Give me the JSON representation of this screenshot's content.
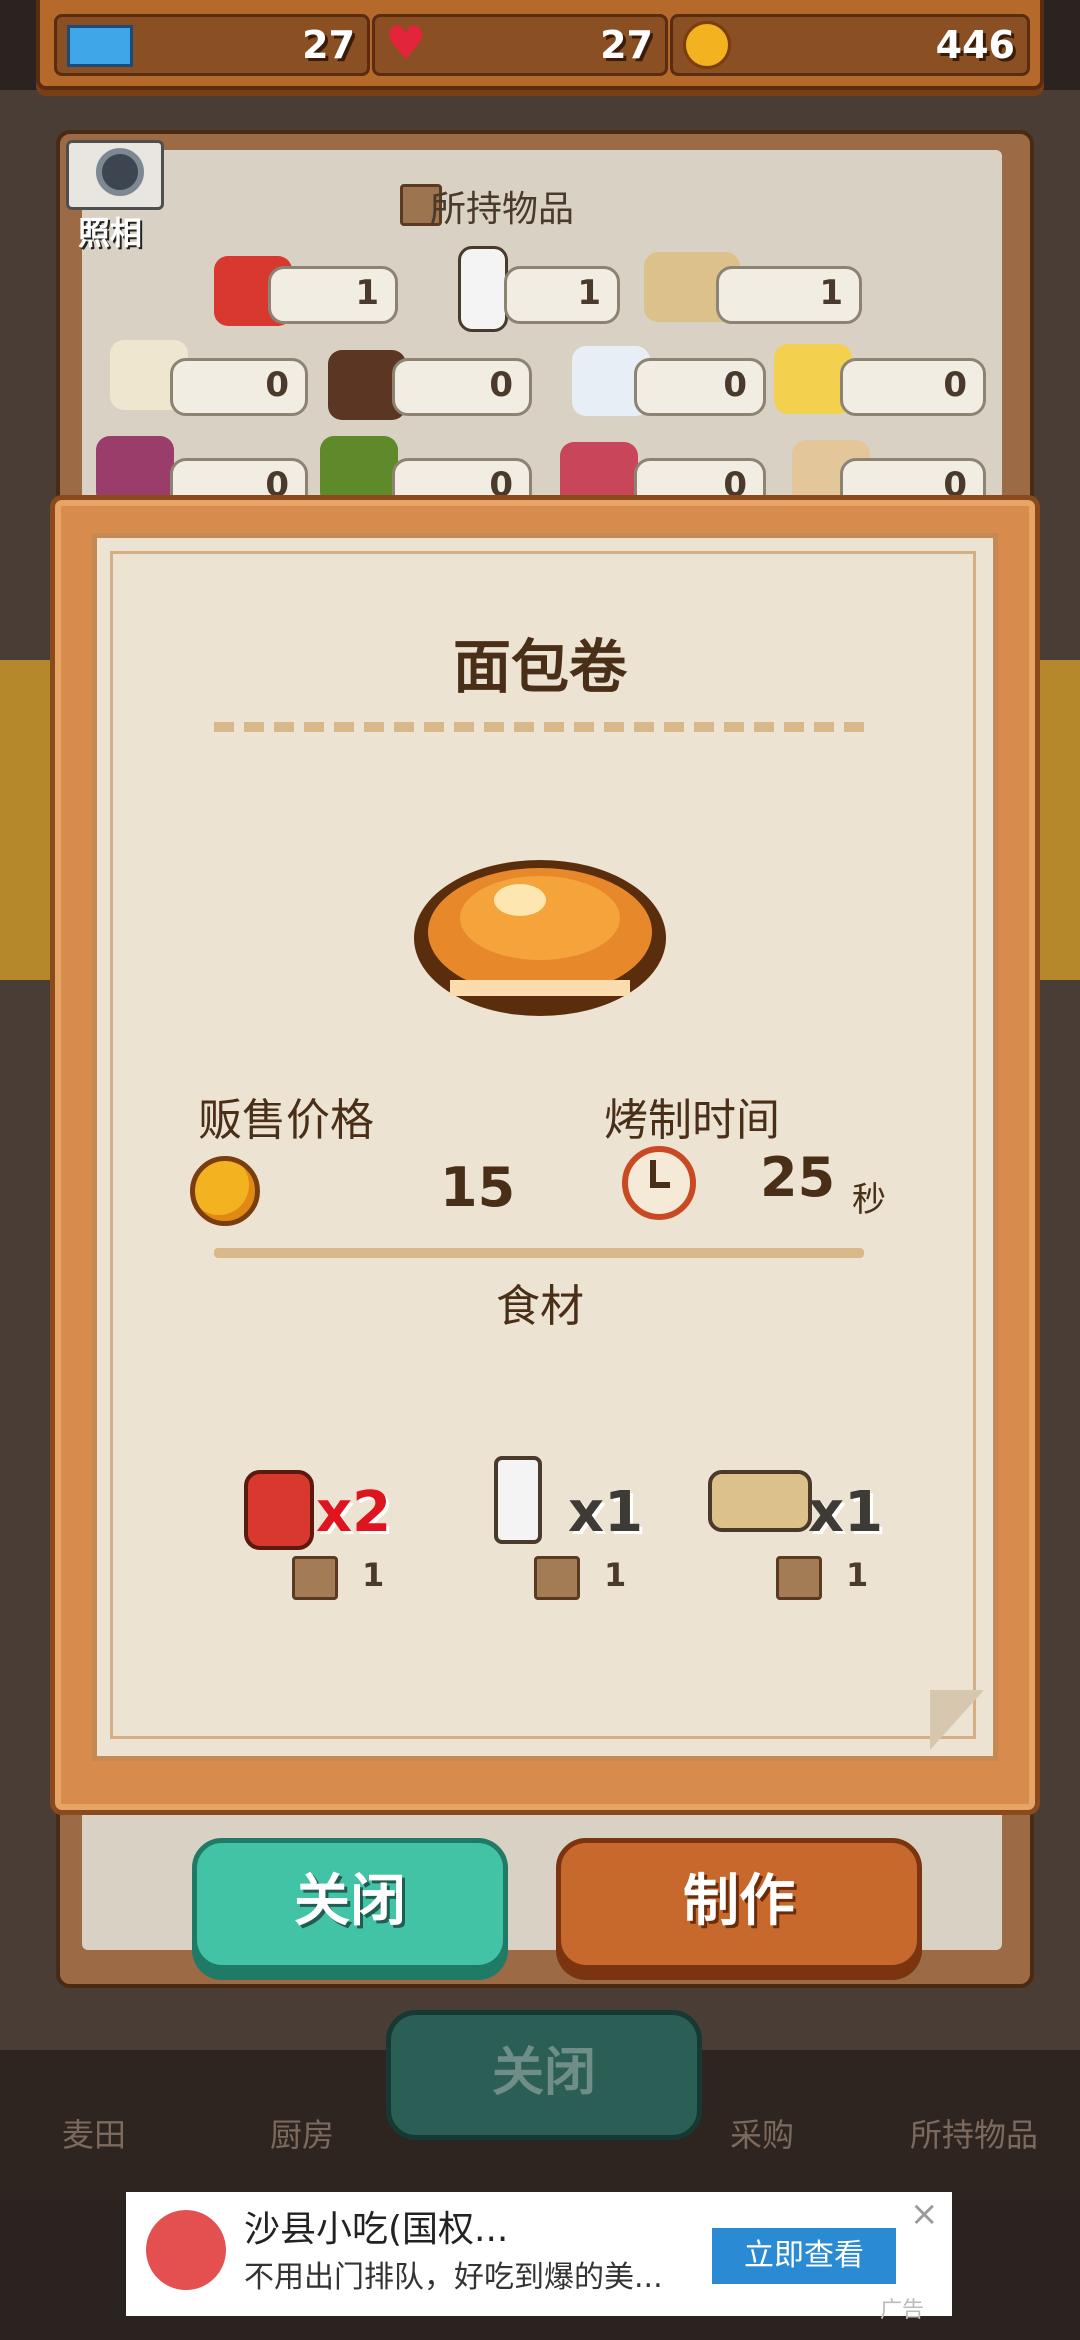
{
  "hud": {
    "tickets": "27",
    "hearts": "27",
    "coins": "446"
  },
  "inventory": {
    "camera_label": "照相",
    "title": "所持物品",
    "slots": [
      "1",
      "1",
      "1",
      "0",
      "0",
      "0",
      "0",
      "0",
      "0",
      "0",
      "0"
    ]
  },
  "recipe": {
    "title": "面包卷",
    "price_label": "贩售价格",
    "price": "15",
    "time_label": "烤制时间",
    "time": "25",
    "time_unit": "秒",
    "ingredients_title": "食材",
    "ingredients": [
      {
        "icon": "flour-bag-icon",
        "need": "x2",
        "own": "1"
      },
      {
        "icon": "milk-bottle-icon",
        "need": "x1",
        "own": "1"
      },
      {
        "icon": "butter-egg-icon",
        "need": "x1",
        "own": "1"
      }
    ],
    "close_label": "关闭",
    "make_label": "制作"
  },
  "nav": {
    "items": [
      "麦田",
      "厨房",
      "采购",
      "所持物品"
    ],
    "close_label": "关闭"
  },
  "ad": {
    "title": "沙县小吃(国权...",
    "desc": "不用出门排队，好吃到爆的美...",
    "button": "立即查看",
    "close": "×",
    "tag": "广告"
  },
  "colors": {
    "accent_green": "#43c3a6",
    "accent_orange": "#c7692c",
    "need_red": "#e0141e"
  }
}
